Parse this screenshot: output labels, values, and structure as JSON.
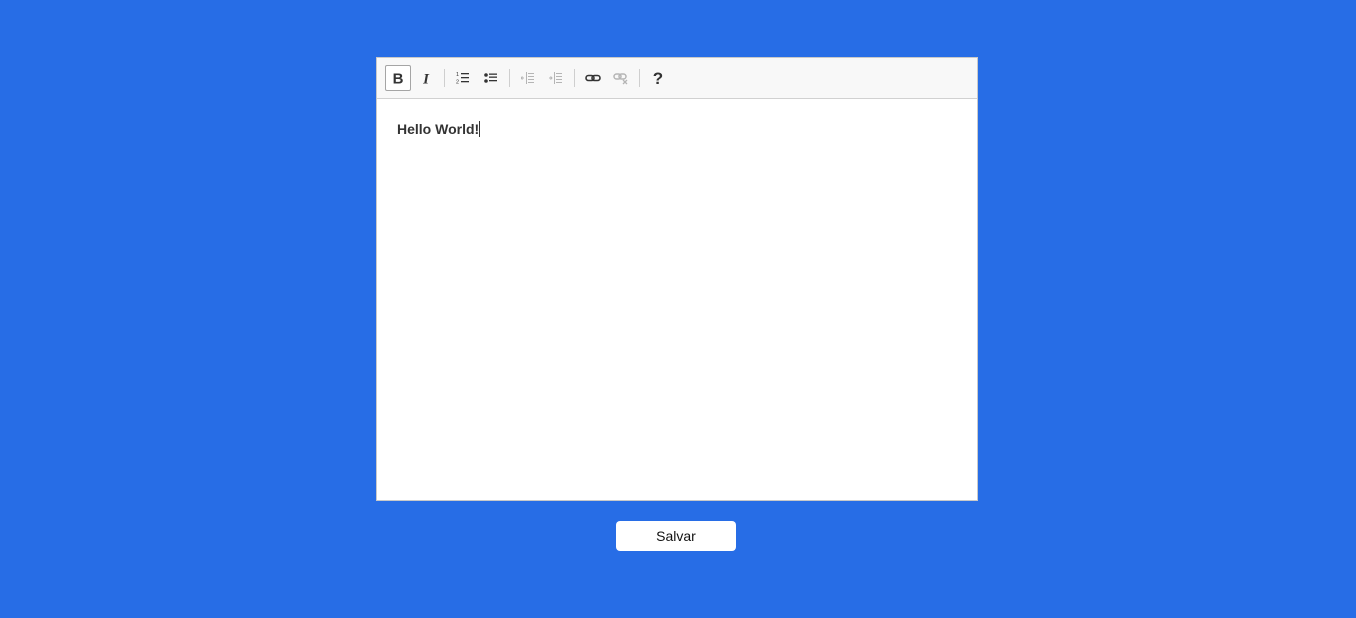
{
  "editor": {
    "content": "Hello World!",
    "toolbar": [
      {
        "icon": "bold-icon",
        "state": "active"
      },
      {
        "icon": "italic-icon",
        "state": "enabled"
      },
      {
        "icon": "numbered-list-icon",
        "state": "enabled"
      },
      {
        "icon": "bulleted-list-icon",
        "state": "enabled"
      },
      {
        "icon": "outdent-icon",
        "state": "disabled"
      },
      {
        "icon": "indent-icon",
        "state": "disabled"
      },
      {
        "icon": "link-icon",
        "state": "enabled"
      },
      {
        "icon": "unlink-icon",
        "state": "disabled"
      },
      {
        "icon": "help-icon",
        "state": "enabled"
      }
    ]
  },
  "save_button": {
    "label": "Salvar"
  },
  "colors": {
    "background": "#276de6",
    "toolbar": "#f8f8f8",
    "icon": "#333333",
    "icon_disabled": "#b5b5b5"
  }
}
